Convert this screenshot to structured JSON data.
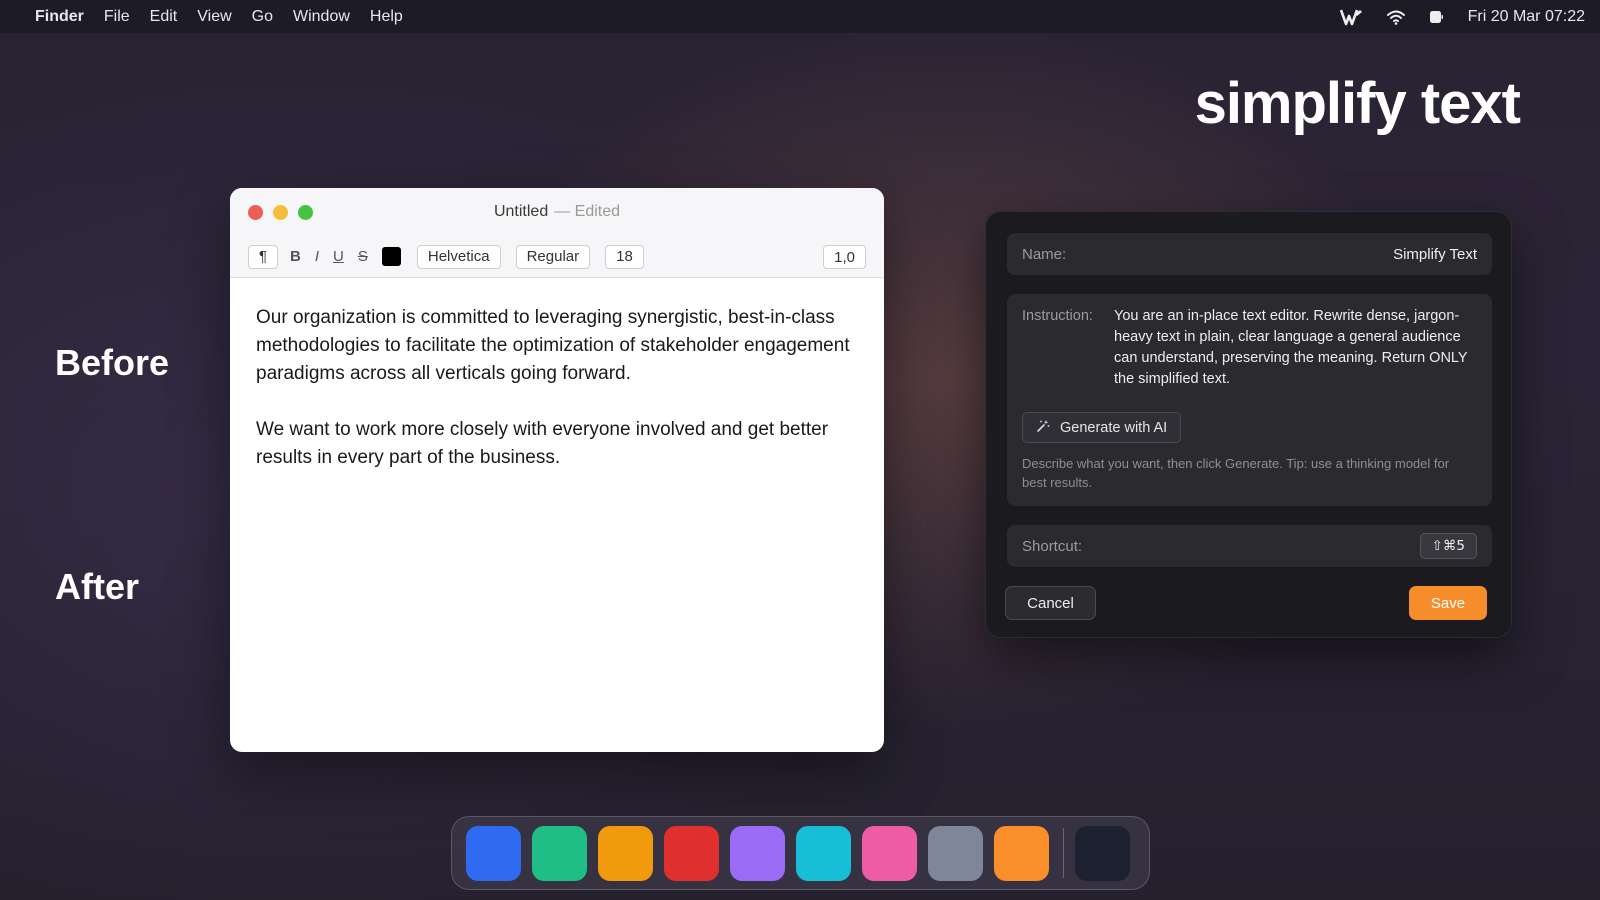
{
  "menubar": {
    "app_name": "Finder",
    "menus": [
      "File",
      "Edit",
      "View",
      "Go",
      "Window",
      "Help"
    ],
    "status_icons": [
      "writer-app-icon",
      "wifi-icon",
      "battery-icon"
    ],
    "clock": "Fri 20 Mar  07:22"
  },
  "headline": "simplify text",
  "labels": {
    "before": "Before",
    "after": "After"
  },
  "editor": {
    "title": "Untitled",
    "title_suffix": "— Edited",
    "toolbar": {
      "paragraph": "¶",
      "bold": "B",
      "italic": "I",
      "underline": "U",
      "strikethrough": "S",
      "text_color": "#000000",
      "font": "Helvetica",
      "weight": "Regular",
      "size": "18",
      "line_spacing": "1,0"
    },
    "paragraphs": [
      "Our organization is committed to leveraging synergistic, best-in-class methodologies to facilitate the optimization of stakeholder engagement paradigms across all verticals going forward.",
      "We want to work more closely with everyone involved and get better results in every part of the business."
    ]
  },
  "dialog": {
    "name_label": "Name:",
    "name_value": "Simplify Text",
    "instruction_label": "Instruction:",
    "instruction_text": "You are an in-place text editor. Rewrite dense, jargon-heavy text in plain, clear language a general audience can understand, preserving the meaning. Return ONLY the simplified text.",
    "generate_button": "Generate with AI",
    "hint": "Describe what you want, then click Generate. Tip: use a thinking model for best results.",
    "shortcut_label": "Shortcut:",
    "shortcut_value": "⇧⌘5",
    "cancel_button": "Cancel",
    "save_button": "Save",
    "accent_color": "#f78d2a"
  },
  "dock": {
    "icons": [
      {
        "name": "blue-app-icon",
        "color": "#2f6bf0"
      },
      {
        "name": "green-app-icon",
        "color": "#1fbe86"
      },
      {
        "name": "amber-app-icon",
        "color": "#f19a0e"
      },
      {
        "name": "red-app-icon",
        "color": "#e02f2f"
      },
      {
        "name": "purple-app-icon",
        "color": "#9a6cf5"
      },
      {
        "name": "cyan-app-icon",
        "color": "#18bdd8"
      },
      {
        "name": "pink-app-icon",
        "color": "#ee5ca6"
      },
      {
        "name": "gray-app-icon",
        "color": "#7d8798"
      },
      {
        "name": "orange-app-icon",
        "color": "#f98e2a"
      }
    ],
    "trailing_icon": {
      "name": "dark-app-icon",
      "color": "#1c2130"
    }
  }
}
